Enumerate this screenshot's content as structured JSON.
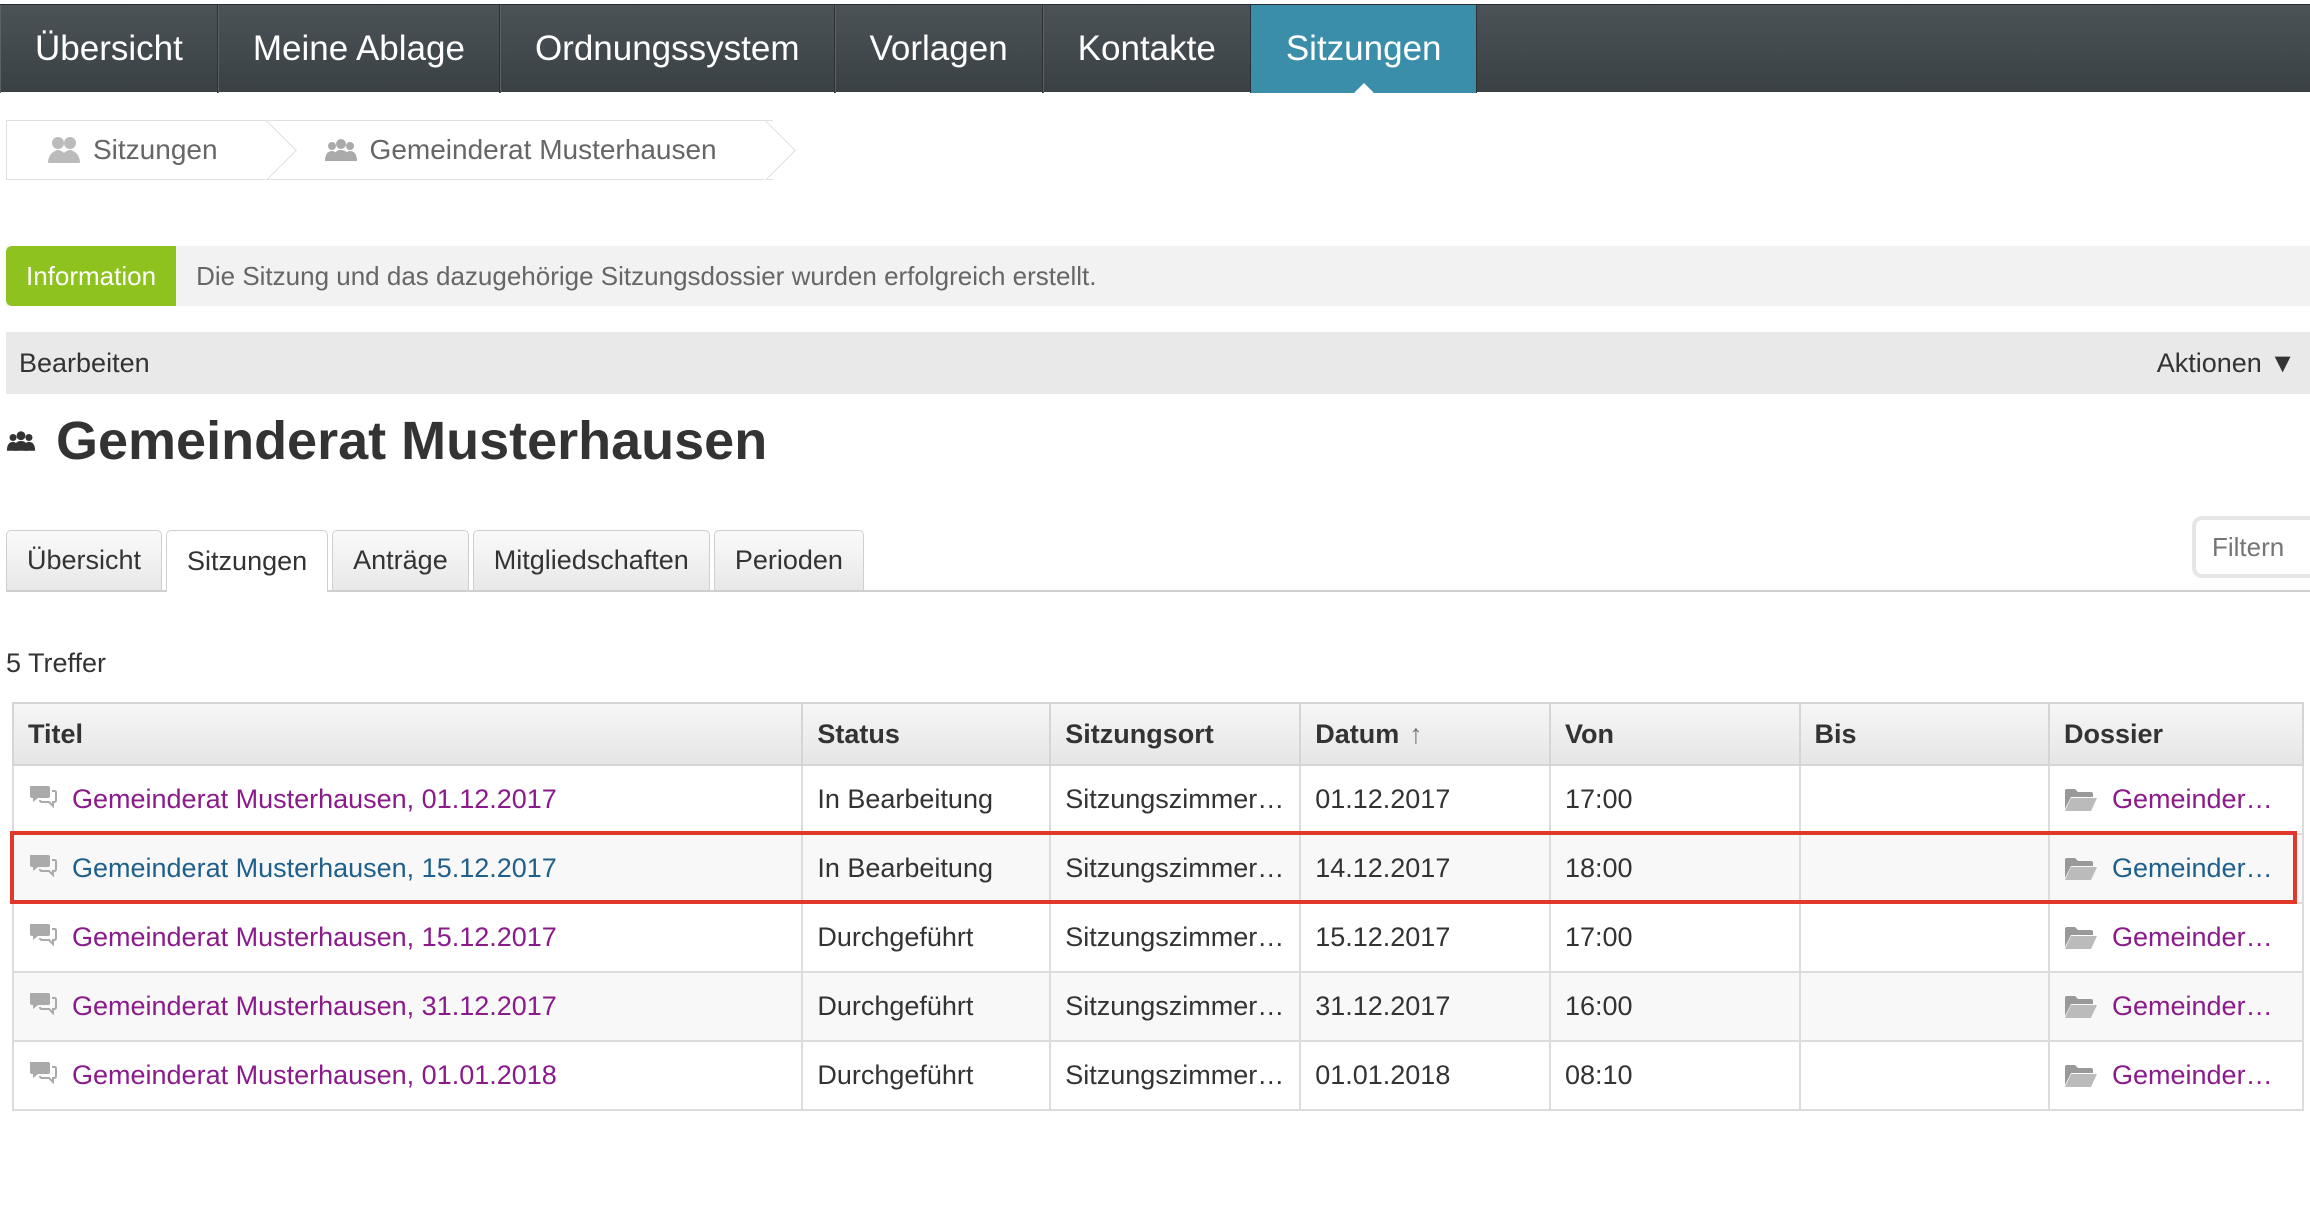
{
  "topnav": {
    "items": [
      {
        "label": "Übersicht"
      },
      {
        "label": "Meine Ablage"
      },
      {
        "label": "Ordnungssystem"
      },
      {
        "label": "Vorlagen"
      },
      {
        "label": "Kontakte"
      },
      {
        "label": "Sitzungen",
        "active": true
      }
    ]
  },
  "breadcrumb": {
    "items": [
      {
        "label": "Sitzungen",
        "icon": "meetings-icon"
      },
      {
        "label": "Gemeinderat Musterhausen",
        "icon": "group-icon"
      }
    ]
  },
  "info": {
    "badge": "Information",
    "message": "Die Sitzung und das dazugehörige Sitzungsdossier wurden erfolgreich erstellt."
  },
  "actionbar": {
    "edit_label": "Bearbeiten",
    "actions_label": "Aktionen ▼"
  },
  "page": {
    "title": "Gemeinderat Musterhausen",
    "title_icon": "group-icon"
  },
  "tabs": [
    {
      "label": "Übersicht"
    },
    {
      "label": "Sitzungen",
      "active": true
    },
    {
      "label": "Anträge"
    },
    {
      "label": "Mitgliedschaften"
    },
    {
      "label": "Perioden"
    }
  ],
  "filter": {
    "placeholder": "Filtern"
  },
  "results": {
    "count_label": "5 Treffer"
  },
  "table": {
    "headers": {
      "titel": "Titel",
      "status": "Status",
      "ort": "Sitzungsort",
      "datum": "Datum",
      "von": "Von",
      "bis": "Bis",
      "dossier": "Dossier"
    },
    "sort_indicator": "↑",
    "rows": [
      {
        "titel": "Gemeinderat Musterhausen, 01.12.2017",
        "status": "In Bearbeitung",
        "ort": "Sitzungszimmer…",
        "datum": "01.12.2017",
        "von": "17:00",
        "bis": "",
        "dossier": "Gemeinder…",
        "link_color": "#8b1a8b"
      },
      {
        "titel": "Gemeinderat Musterhausen, 15.12.2017",
        "status": "In Bearbeitung",
        "ort": "Sitzungszimmer…",
        "datum": "14.12.2017",
        "von": "18:00",
        "bis": "",
        "dossier": "Gemeinder…",
        "link_color": "#1f5f8b",
        "highlighted": true
      },
      {
        "titel": "Gemeinderat Musterhausen, 15.12.2017",
        "status": "Durchgeführt",
        "ort": "Sitzungszimmer…",
        "datum": "15.12.2017",
        "von": "17:00",
        "bis": "",
        "dossier": "Gemeinder…",
        "link_color": "#8b1a8b"
      },
      {
        "titel": "Gemeinderat Musterhausen, 31.12.2017",
        "status": "Durchgeführt",
        "ort": "Sitzungszimmer…",
        "datum": "31.12.2017",
        "von": "16:00",
        "bis": "",
        "dossier": "Gemeinder…",
        "link_color": "#8b1a8b"
      },
      {
        "titel": "Gemeinderat Musterhausen, 01.01.2018",
        "status": "Durchgeführt",
        "ort": "Sitzungszimmer…",
        "datum": "01.01.2018",
        "von": "08:10",
        "bis": "",
        "dossier": "Gemeinder…",
        "link_color": "#8b1a8b"
      }
    ]
  },
  "colors": {
    "nav_active": "#3a8eaa",
    "badge": "#8dc21f",
    "highlight_border": "#e0392b"
  }
}
